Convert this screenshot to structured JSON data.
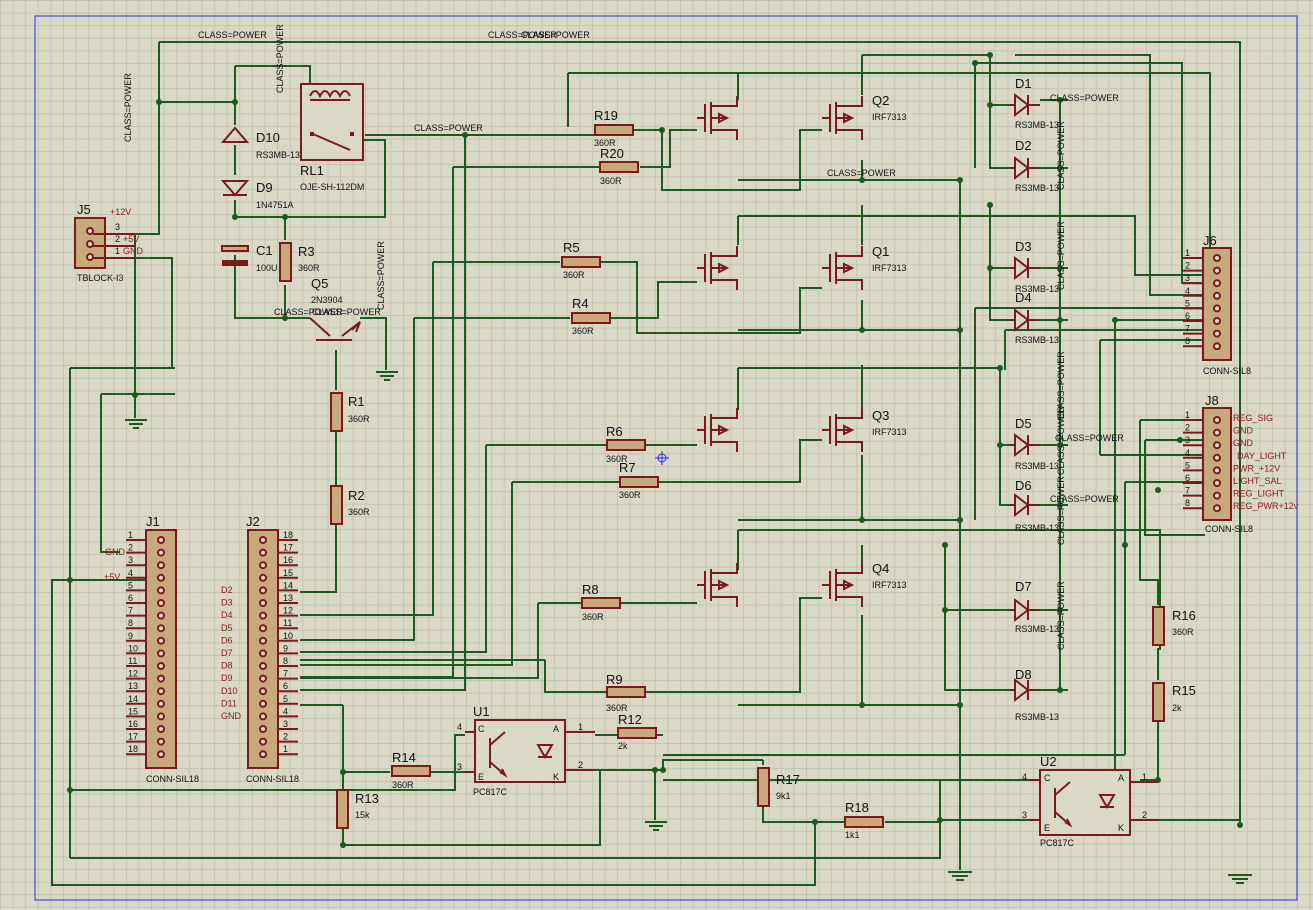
{
  "components": {
    "d10": {
      "ref": "D10",
      "value": "RS3MB-13"
    },
    "d9": {
      "ref": "D9",
      "value": "1N4751A"
    },
    "rl1": {
      "ref": "RL1",
      "value": "OJE-SH-112DM"
    },
    "c1": {
      "ref": "C1",
      "value": "100U"
    },
    "r3": {
      "ref": "R3",
      "value": "360R"
    },
    "q5": {
      "ref": "Q5",
      "value": "2N3904"
    },
    "r1": {
      "ref": "R1",
      "value": "360R"
    },
    "r2": {
      "ref": "R2",
      "value": "360R"
    },
    "j5": {
      "ref": "J5",
      "value": "TBLOCK-I3",
      "pins": [
        "3",
        "2",
        "1"
      ],
      "nets": [
        "+12V",
        "+5V",
        "GND"
      ]
    },
    "j1": {
      "ref": "J1",
      "value": "CONN-SIL18",
      "nets": [
        "GND",
        "+5V"
      ]
    },
    "j2": {
      "ref": "J2",
      "value": "CONN-SIL18",
      "nets": [
        "D2",
        "D3",
        "D4",
        "D5",
        "D6",
        "D7",
        "D8",
        "D9",
        "D10",
        "D11",
        "GND"
      ]
    },
    "r19": {
      "ref": "R19",
      "value": "360R"
    },
    "r20": {
      "ref": "R20",
      "value": "360R"
    },
    "r5": {
      "ref": "R5",
      "value": "360R"
    },
    "r4": {
      "ref": "R4",
      "value": "360R"
    },
    "r6": {
      "ref": "R6",
      "value": "360R"
    },
    "r7": {
      "ref": "R7",
      "value": "360R"
    },
    "r8": {
      "ref": "R8",
      "value": "360R"
    },
    "r9": {
      "ref": "R9",
      "value": "360R"
    },
    "q2": {
      "ref": "Q2",
      "value": "IRF7313"
    },
    "q1": {
      "ref": "Q1",
      "value": "IRF7313"
    },
    "q3": {
      "ref": "Q3",
      "value": "IRF7313"
    },
    "q4": {
      "ref": "Q4",
      "value": "IRF7313"
    },
    "d1": {
      "ref": "D1",
      "value": "RS3MB-13"
    },
    "d2": {
      "ref": "D2",
      "value": "RS3MB-13"
    },
    "d3": {
      "ref": "D3",
      "value": "RS3MB-13"
    },
    "d4": {
      "ref": "D4",
      "value": "RS3MB-13"
    },
    "d5": {
      "ref": "D5",
      "value": "RS3MB-13"
    },
    "d6": {
      "ref": "D6",
      "value": "RS3MB-13"
    },
    "d7": {
      "ref": "D7",
      "value": "RS3MB-13"
    },
    "d8": {
      "ref": "D8",
      "value": "RS3MB-13"
    },
    "j6": {
      "ref": "J6",
      "value": "CONN-SIL8"
    },
    "j8": {
      "ref": "J8",
      "value": "CONN-SIL8",
      "nets": [
        "REG_SIG",
        "GND",
        "GND",
        "DAY_LIGHT",
        "PWR_+12V",
        "LIGHT_SAL",
        "REG_LIGHT",
        "REG_PWR+12v"
      ]
    },
    "r16": {
      "ref": "R16",
      "value": "360R"
    },
    "r15": {
      "ref": "R15",
      "value": "2k"
    },
    "u1": {
      "ref": "U1",
      "value": "PC817C"
    },
    "u2": {
      "ref": "U2",
      "value": "PC817C"
    },
    "r12": {
      "ref": "R12",
      "value": "2k"
    },
    "r14": {
      "ref": "R14",
      "value": "360R"
    },
    "r13": {
      "ref": "R13",
      "value": "15k"
    },
    "r17": {
      "ref": "R17",
      "value": "9k1"
    },
    "r18": {
      "ref": "R18",
      "value": "1k1"
    }
  },
  "net_labels": {
    "class_power": "CLASS=POWER",
    "class_power_overlap": "CLASS=POWER"
  }
}
